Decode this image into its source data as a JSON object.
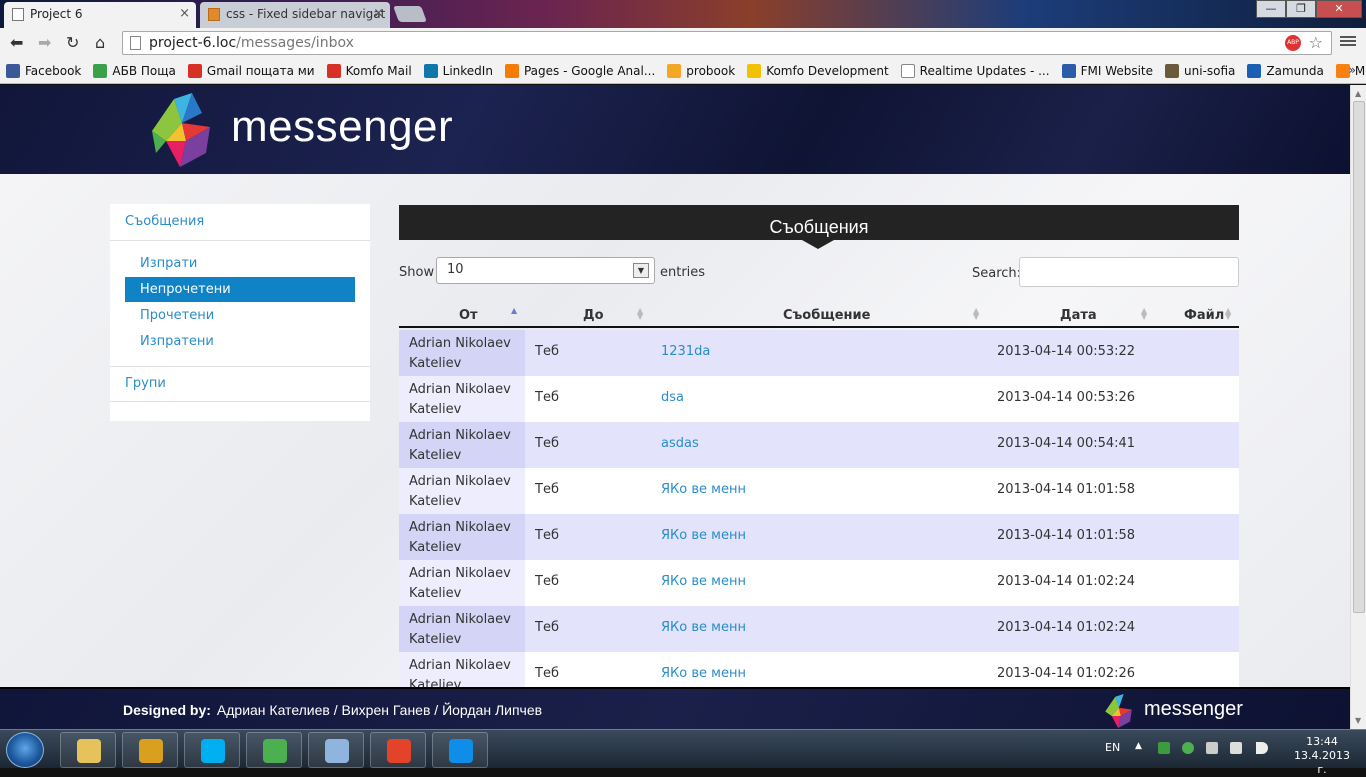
{
  "browser": {
    "tabs": [
      {
        "title": "Project 6",
        "active": true
      },
      {
        "title": "css - Fixed sidebar navigat",
        "active": false
      }
    ],
    "window_controls": {
      "minimize": "—",
      "maximize": "❐",
      "close": "✕"
    },
    "address": {
      "host": "project-6.loc",
      "path": "/messages/inbox"
    },
    "bookmarks": [
      {
        "label": "Facebook",
        "color": "#3b5998"
      },
      {
        "label": "АБВ Поща",
        "color": "#3aa14a"
      },
      {
        "label": "Gmail пощата ми",
        "color": "#d93025"
      },
      {
        "label": "Komfo Mail",
        "color": "#d93025"
      },
      {
        "label": "LinkedIn",
        "color": "#0e76a8"
      },
      {
        "label": "Pages - Google Anal...",
        "color": "#f57c00"
      },
      {
        "label": "probook",
        "color": "#f5a623"
      },
      {
        "label": "Komfo Development",
        "color": "#f2c200"
      },
      {
        "label": "Realtime Updates - ...",
        "color": "#ffffff"
      },
      {
        "label": "FMI Website",
        "color": "#2a5caa"
      },
      {
        "label": "uni-sofia",
        "color": "#6b5a3a"
      },
      {
        "label": "Zamunda",
        "color": "#1a5fb4"
      },
      {
        "label": "Moodle",
        "color": "#f98012"
      }
    ],
    "bookmarks_more": "»"
  },
  "app": {
    "logo_text": "messenger",
    "sidebar": {
      "heading": "Съобщения",
      "items": [
        {
          "label": "Изпрати",
          "active": false
        },
        {
          "label": "Непрочетени",
          "active": true
        },
        {
          "label": "Прочетени",
          "active": false
        },
        {
          "label": "Изпратени",
          "active": false
        }
      ],
      "groups": "Групи"
    },
    "panel_title": "Съобщения",
    "table_controls": {
      "show_label": "Show",
      "page_size": "10",
      "entries_label": "entries",
      "search_label": "Search:",
      "search_value": ""
    },
    "columns": [
      "От",
      "До",
      "Съобщение",
      "Дата",
      "Файл"
    ],
    "rows": [
      {
        "from1": "Adrian Nikolaev",
        "from2": "Kateliev",
        "to": "Теб",
        "message": "1231da",
        "date": "2013-04-14 00:53:22"
      },
      {
        "from1": "Adrian Nikolaev",
        "from2": "Kateliev",
        "to": "Теб",
        "message": "dsa",
        "date": "2013-04-14 00:53:26"
      },
      {
        "from1": "Adrian Nikolaev",
        "from2": "Kateliev",
        "to": "Теб",
        "message": "asdas",
        "date": "2013-04-14 00:54:41"
      },
      {
        "from1": "Adrian Nikolaev",
        "from2": "Kateliev",
        "to": "Теб",
        "message": "ЯКо ве менн",
        "date": "2013-04-14 01:01:58"
      },
      {
        "from1": "Adrian Nikolaev",
        "from2": "Kateliev",
        "to": "Теб",
        "message": "ЯКо ве менн",
        "date": "2013-04-14 01:01:58"
      },
      {
        "from1": "Adrian Nikolaev",
        "from2": "Kateliev",
        "to": "Теб",
        "message": "ЯКо ве менн",
        "date": "2013-04-14 01:02:24"
      },
      {
        "from1": "Adrian Nikolaev",
        "from2": "Kateliev",
        "to": "Теб",
        "message": "ЯКо ве менн",
        "date": "2013-04-14 01:02:24"
      },
      {
        "from1": "Adrian Nikolaev",
        "from2": "Kateliev",
        "to": "Теб",
        "message": "ЯКо ве менн",
        "date": "2013-04-14 01:02:26"
      }
    ],
    "footer": {
      "designed_by_label": "Designed by:",
      "designers": "Адриан Кателиев / Вихрен Ганев / Йордан Липчев",
      "logo_text": "messenger"
    }
  },
  "taskbar": {
    "apps": [
      {
        "name": "explorer",
        "color": "#e6c35a"
      },
      {
        "name": "winamp",
        "color": "#d8a01e"
      },
      {
        "name": "skype",
        "color": "#00aff0"
      },
      {
        "name": "chrome",
        "color": "#4caf50"
      },
      {
        "name": "virtualbox",
        "color": "#8fb4dd"
      },
      {
        "name": "git",
        "color": "#e24329"
      },
      {
        "name": "teamviewer",
        "color": "#0e8ee9"
      }
    ],
    "language": "EN",
    "tray_arrow": "▲",
    "time": "13:44",
    "date": "13.4.2013 г."
  },
  "colors": {
    "accent": "#0f83c6",
    "link": "#2a8dc8",
    "header_bg": "#1c2350",
    "panel_header": "#232323",
    "row_odd": "#e3e3fc"
  }
}
